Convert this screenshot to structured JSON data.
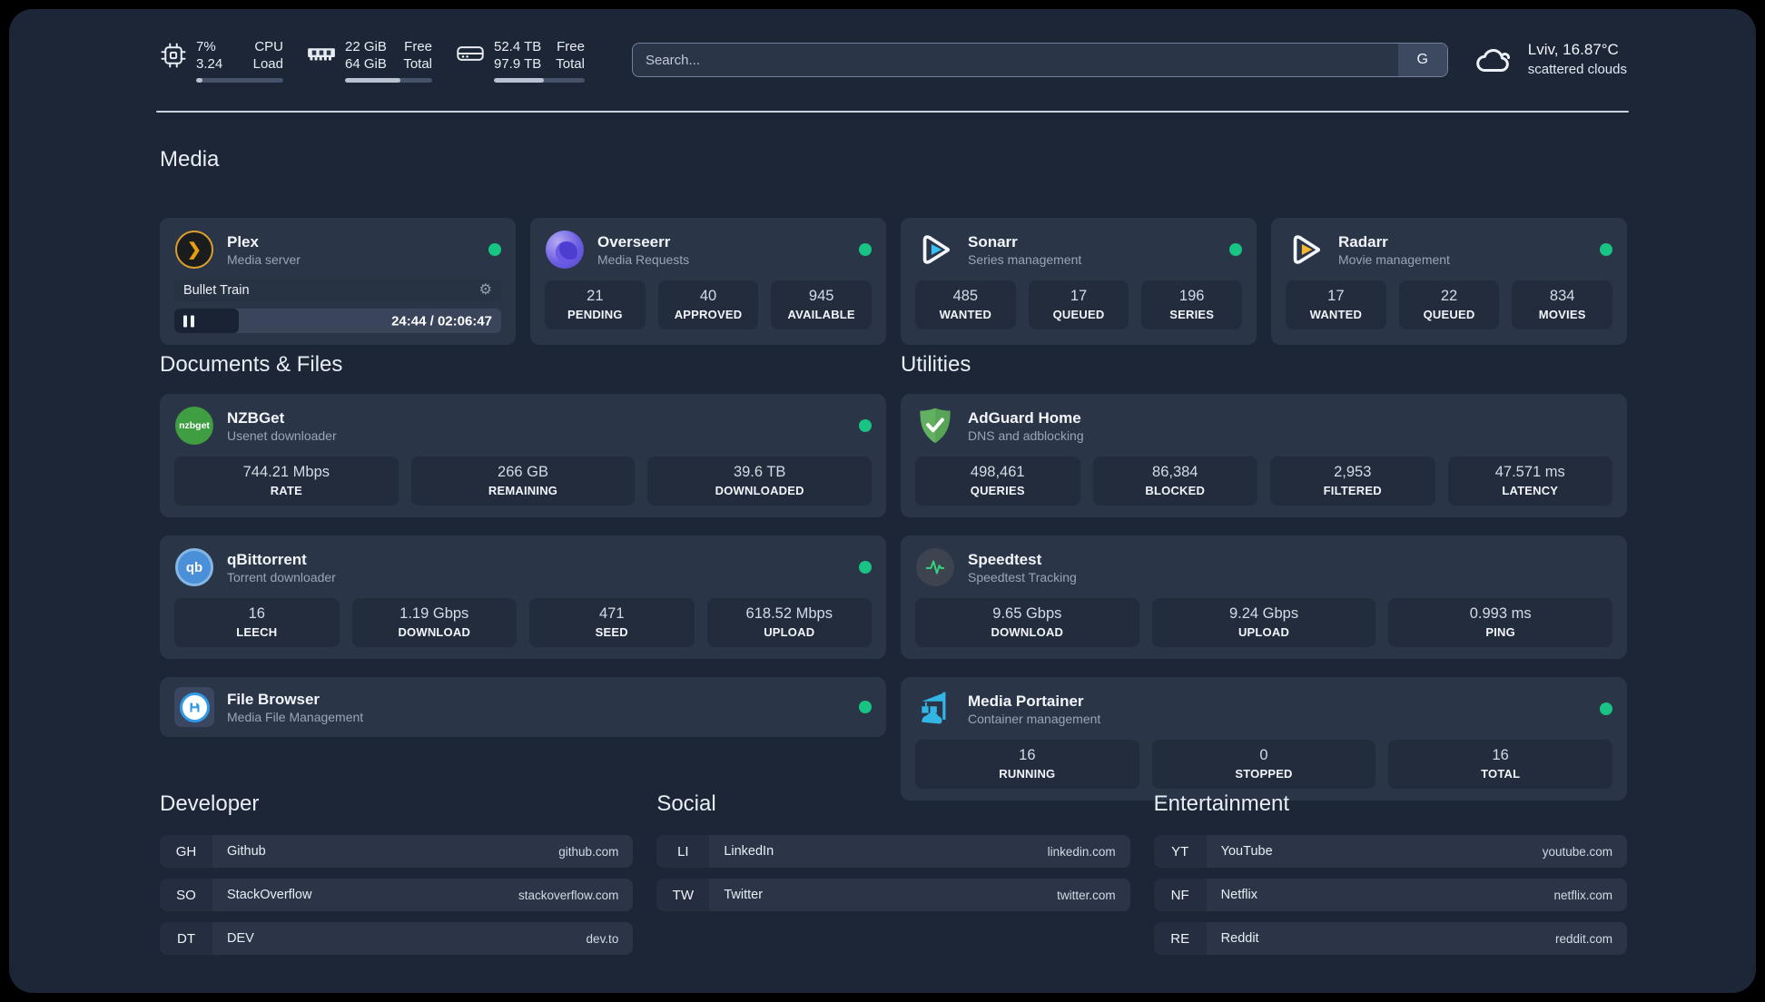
{
  "topbar": {
    "cpu": {
      "value_top": "7%",
      "value_bottom": "3.24",
      "label_top": "CPU",
      "label_bottom": "Load",
      "progress_percent": 7
    },
    "memory": {
      "value_top": "22 GiB",
      "value_bottom": "64 GiB",
      "label_top": "Free",
      "label_bottom": "Total",
      "progress_percent": 64
    },
    "storage": {
      "value_top": "52.4 TB",
      "value_bottom": "97.9 TB",
      "label_top": "Free",
      "label_bottom": "Total",
      "progress_percent": 55
    },
    "search": {
      "placeholder": "Search...",
      "engine_button": "G"
    },
    "weather": {
      "location_temp": "Lviv, 16.87°C",
      "condition": "scattered clouds"
    }
  },
  "sections": {
    "media": "Media",
    "documents": "Documents & Files",
    "utilities": "Utilities",
    "developer": "Developer",
    "social": "Social",
    "entertainment": "Entertainment"
  },
  "apps": {
    "plex": {
      "name": "Plex",
      "subtitle": "Media server",
      "online": true,
      "player": {
        "title": "Bullet Train",
        "time": "24:44 / 02:06:47",
        "progress_percent": 19.6
      }
    },
    "overseerr": {
      "name": "Overseerr",
      "subtitle": "Media Requests",
      "online": true,
      "stats": [
        {
          "value": "21",
          "label": "PENDING"
        },
        {
          "value": "40",
          "label": "APPROVED"
        },
        {
          "value": "945",
          "label": "AVAILABLE"
        }
      ]
    },
    "sonarr": {
      "name": "Sonarr",
      "subtitle": "Series management",
      "online": true,
      "stats": [
        {
          "value": "485",
          "label": "WANTED"
        },
        {
          "value": "17",
          "label": "QUEUED"
        },
        {
          "value": "196",
          "label": "SERIES"
        }
      ]
    },
    "radarr": {
      "name": "Radarr",
      "subtitle": "Movie management",
      "online": true,
      "stats": [
        {
          "value": "17",
          "label": "WANTED"
        },
        {
          "value": "22",
          "label": "QUEUED"
        },
        {
          "value": "834",
          "label": "MOVIES"
        }
      ]
    },
    "nzbget": {
      "name": "NZBGet",
      "subtitle": "Usenet downloader",
      "online": true,
      "icon_text": "nzbget",
      "stats": [
        {
          "value": "744.21 Mbps",
          "label": "RATE"
        },
        {
          "value": "266 GB",
          "label": "REMAINING"
        },
        {
          "value": "39.6 TB",
          "label": "DOWNLOADED"
        }
      ]
    },
    "qbittorrent": {
      "name": "qBittorrent",
      "subtitle": "Torrent downloader",
      "online": true,
      "icon_text": "qb",
      "stats": [
        {
          "value": "16",
          "label": "LEECH"
        },
        {
          "value": "1.19 Gbps",
          "label": "DOWNLOAD"
        },
        {
          "value": "471",
          "label": "SEED"
        },
        {
          "value": "618.52 Mbps",
          "label": "UPLOAD"
        }
      ]
    },
    "filebrowser": {
      "name": "File Browser",
      "subtitle": "Media File Management",
      "online": true
    },
    "adguard": {
      "name": "AdGuard Home",
      "subtitle": "DNS and adblocking",
      "online": false,
      "stats": [
        {
          "value": "498,461",
          "label": "QUERIES"
        },
        {
          "value": "86,384",
          "label": "BLOCKED"
        },
        {
          "value": "2,953",
          "label": "FILTERED"
        },
        {
          "value": "47.571 ms",
          "label": "LATENCY"
        }
      ]
    },
    "speedtest": {
      "name": "Speedtest",
      "subtitle": "Speedtest Tracking",
      "online": false,
      "stats": [
        {
          "value": "9.65 Gbps",
          "label": "DOWNLOAD"
        },
        {
          "value": "9.24 Gbps",
          "label": "UPLOAD"
        },
        {
          "value": "0.993 ms",
          "label": "PING"
        }
      ]
    },
    "portainer": {
      "name": "Media Portainer",
      "subtitle": "Container management",
      "online": true,
      "stats": [
        {
          "value": "16",
          "label": "RUNNING"
        },
        {
          "value": "0",
          "label": "STOPPED"
        },
        {
          "value": "16",
          "label": "TOTAL"
        }
      ]
    }
  },
  "bookmarks": {
    "developer": [
      {
        "abbr": "GH",
        "name": "Github",
        "url": "github.com"
      },
      {
        "abbr": "SO",
        "name": "StackOverflow",
        "url": "stackoverflow.com"
      },
      {
        "abbr": "DT",
        "name": "DEV",
        "url": "dev.to"
      }
    ],
    "social": [
      {
        "abbr": "LI",
        "name": "LinkedIn",
        "url": "linkedin.com"
      },
      {
        "abbr": "TW",
        "name": "Twitter",
        "url": "twitter.com"
      }
    ],
    "entertainment": [
      {
        "abbr": "YT",
        "name": "YouTube",
        "url": "youtube.com"
      },
      {
        "abbr": "NF",
        "name": "Netflix",
        "url": "netflix.com"
      },
      {
        "abbr": "RE",
        "name": "Reddit",
        "url": "reddit.com"
      }
    ]
  },
  "colors": {
    "background": "#1c2636",
    "card": "#2a3547",
    "stat_box": "#222c3d",
    "online_dot": "#18c383",
    "plex_gold": "#e5a00d",
    "sonarr_blue": "#38c1f1",
    "radarr_amber": "#f7b731",
    "nzbget_green": "#3f9e42",
    "qbittorrent_blue": "#4a90d9",
    "adguard_green": "#62b162",
    "speedtest_pulse": "#35d07e",
    "portainer_blue": "#33b5e5"
  }
}
